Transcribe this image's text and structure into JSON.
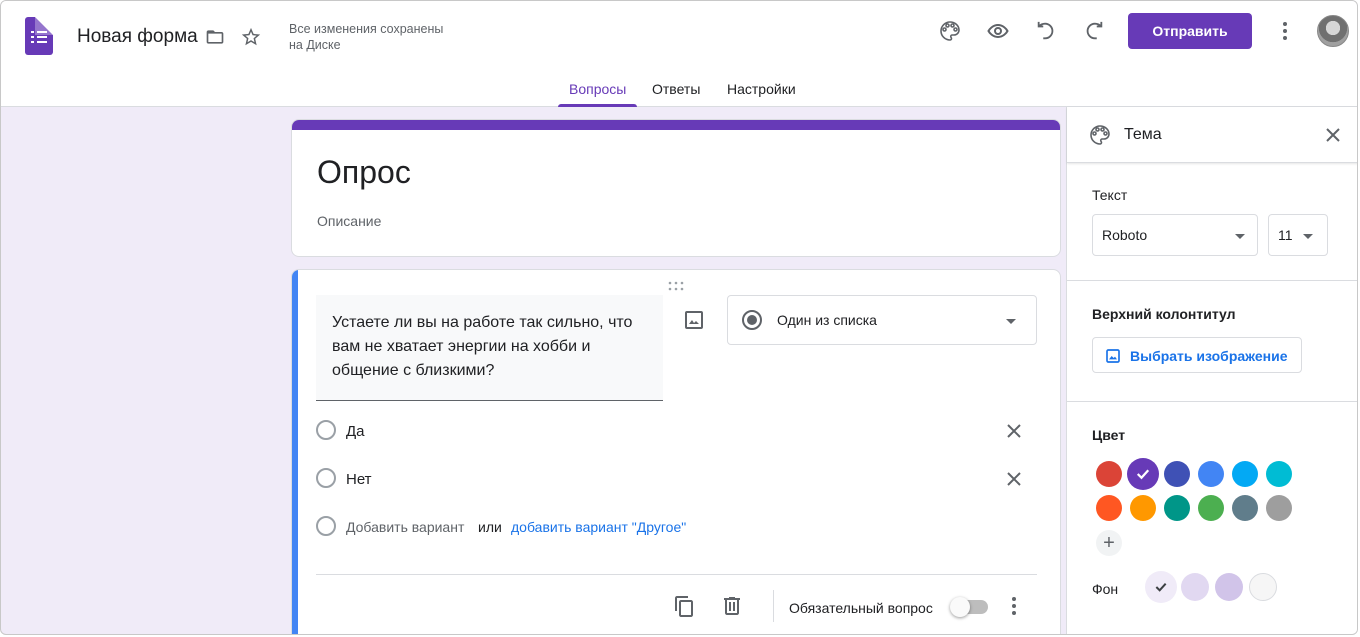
{
  "header": {
    "doc_title": "Новая форма",
    "save_status_line1": "Все изменения сохранены",
    "save_status_line2": "на Диске",
    "send_label": "Отправить"
  },
  "tabs": [
    {
      "label": "Вопросы",
      "active": true
    },
    {
      "label": "Ответы",
      "active": false
    },
    {
      "label": "Настройки",
      "active": false
    }
  ],
  "form": {
    "title": "Опрос",
    "description_placeholder": "Описание"
  },
  "question": {
    "text": "Устаете ли вы на работе так сильно, что вам не хватает энергии на хобби и общение с близкими?",
    "type_label": "Один из списка",
    "options": [
      "Да",
      "Нет"
    ],
    "add_option": "Добавить вариант",
    "add_or": "или",
    "add_other": "добавить вариант \"Другое\"",
    "required_label": "Обязательный вопрос",
    "required": false
  },
  "theme_panel": {
    "title": "Тема",
    "text_label": "Текст",
    "font_value": "Roboto",
    "size_value": "11",
    "header_label": "Верхний колонтитул",
    "choose_image": "Выбрать изображение",
    "color_label": "Цвет",
    "background_label": "Фон",
    "colors_row1": [
      "#db4437",
      "#673ab7",
      "#3f51b5",
      "#4285f4",
      "#03a9f4",
      "#00bcd4"
    ],
    "colors_row2": [
      "#ff5722",
      "#ff9800",
      "#009688",
      "#4caf50",
      "#607d8b",
      "#9e9e9e"
    ],
    "selected_color": "#673ab7",
    "backgrounds": [
      "#f0ebf8",
      "#e1d8f1",
      "#d1c4e9",
      "#f6f6f6"
    ]
  },
  "colors": {
    "accent": "#673ab7",
    "link": "#1a73e8",
    "question_bar": "#4285f4"
  }
}
